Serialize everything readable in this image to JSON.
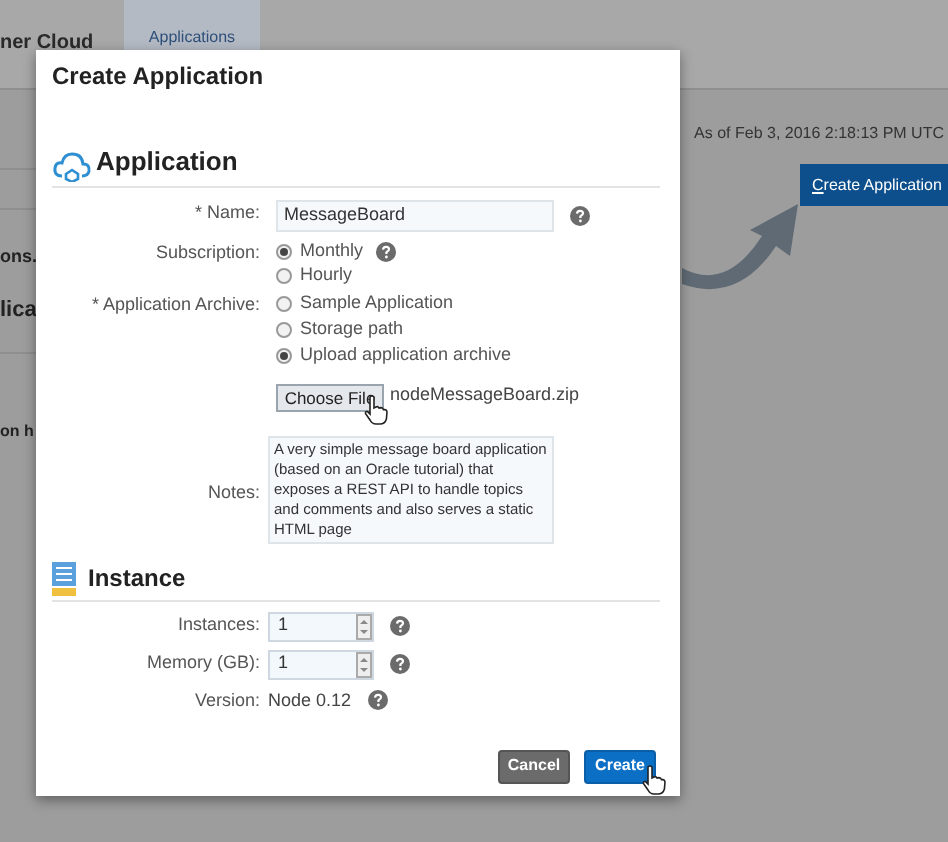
{
  "background_page": {
    "header_title": "ner Cloud",
    "tabs": [
      {
        "label": "Applications",
        "selected": true
      }
    ],
    "timestamp": "As of Feb 3, 2016 2:18:13 PM UTC",
    "create_button": "Create Application",
    "texts": [
      "ons.",
      "lica",
      "on h"
    ]
  },
  "dialog": {
    "title": "Create Application",
    "application_section": {
      "heading": "Application",
      "name": {
        "label": "* Name:",
        "value": "MessageBoard"
      },
      "subscription": {
        "label": "Subscription:",
        "options": [
          {
            "label": "Monthly",
            "selected": true
          },
          {
            "label": "Hourly",
            "selected": false
          }
        ]
      },
      "archive": {
        "label": "* Application Archive:",
        "options": [
          {
            "label": "Sample Application",
            "selected": false
          },
          {
            "label": "Storage path",
            "selected": false
          },
          {
            "label": "Upload application archive",
            "selected": true
          }
        ],
        "choose_button": "Choose File",
        "file_name": "nodeMessageBoard.zip"
      },
      "notes": {
        "label": "Notes:",
        "value": "A very simple message board application (based on an Oracle tutorial) that exposes a REST API to handle topics and comments and also serves a static HTML page"
      }
    },
    "instance_section": {
      "heading": "Instance",
      "instances": {
        "label": "Instances:",
        "value": "1"
      },
      "memory": {
        "label": "Memory (GB):",
        "value": "1"
      },
      "version": {
        "label": "Version:",
        "value": "Node 0.12"
      }
    },
    "buttons": [
      {
        "label": "Cancel",
        "kind": "secondary"
      },
      {
        "label": "Create",
        "kind": "primary"
      }
    ]
  }
}
